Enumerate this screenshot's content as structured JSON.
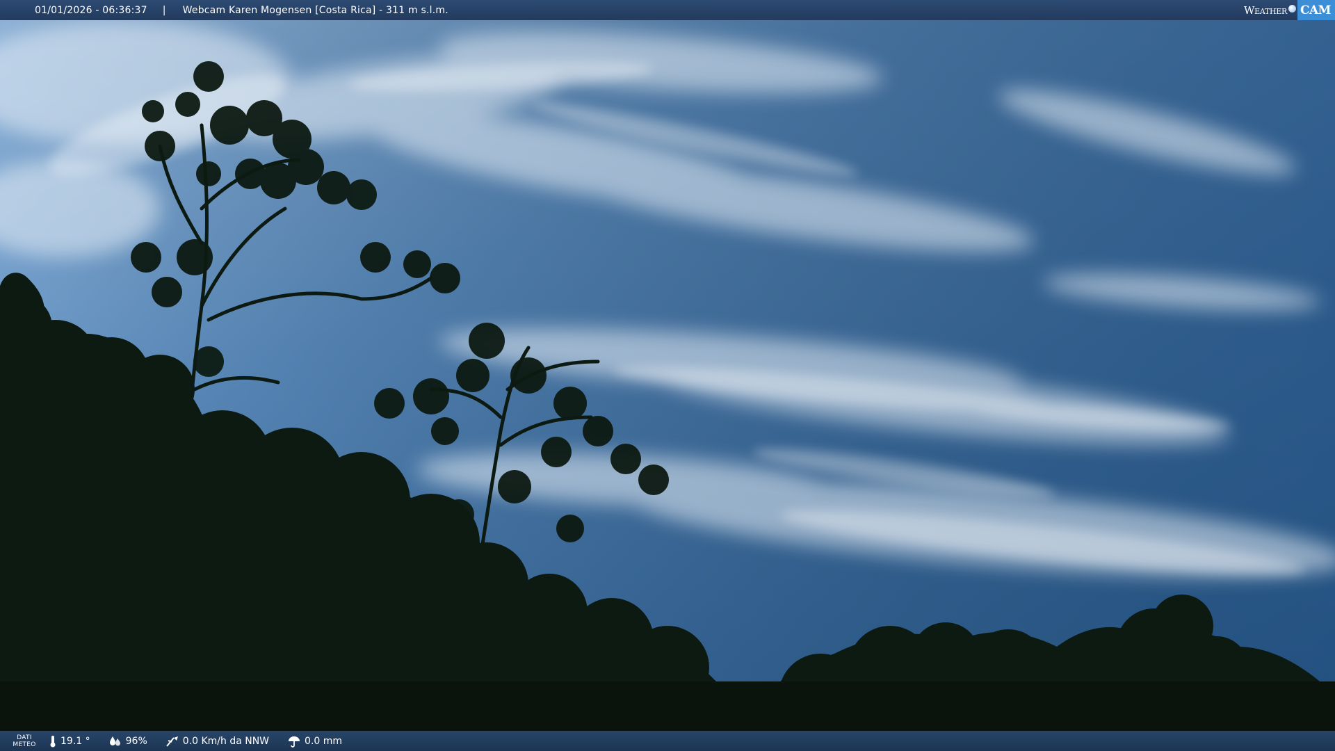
{
  "header": {
    "datetime": "01/01/2026 - 06:36:37",
    "separator": "|",
    "title": "Webcam Karen Mogensen [Costa Rica]  - 311 m s.l.m."
  },
  "logo": {
    "weather": "Weather",
    "cam": "CAM"
  },
  "footer": {
    "dati_line1": "DATI",
    "dati_line2": "METEO",
    "temperature": "19.1 °",
    "temperature_icon": "thermometer-icon",
    "humidity": "96%",
    "humidity_icon": "humidity-drop-icon",
    "wind": "0.0 Km/h da NNW",
    "wind_icon": "wind-icon",
    "rain": "0.0 mm",
    "rain_icon": "rain-umbrella-icon"
  },
  "colors": {
    "bar_bg": "#223b5e",
    "logo_accent": "#3c8fd6",
    "sky_top": "#2c5f93",
    "sky_bottom": "#6d99c6",
    "foliage": "#0c1810"
  }
}
